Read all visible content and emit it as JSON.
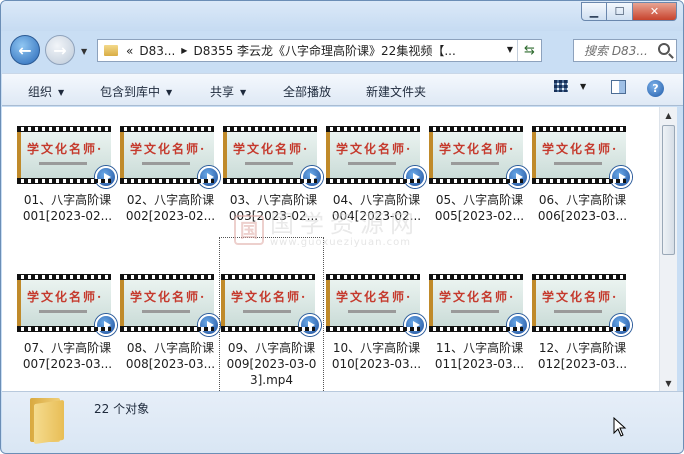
{
  "window": {
    "caption_buttons": {
      "minimize_icon": "minimize-icon",
      "maximize_icon": "maximize-icon",
      "close_icon": "close-icon"
    }
  },
  "nav": {
    "back_icon": "back-arrow-icon",
    "forward_icon": "forward-arrow-icon"
  },
  "address": {
    "overflow": "«",
    "crumbs": [
      "D83...",
      "D8355 李云龙《八字命理高阶课》22集视频【..."
    ]
  },
  "search": {
    "placeholder": "搜索 D83..."
  },
  "toolbar": {
    "organize": "组织",
    "include_library": "包含到库中",
    "share": "共享",
    "play_all": "全部播放",
    "new_folder": "新建文件夹"
  },
  "thumbnail": {
    "title_text": "学文化名师·"
  },
  "files": [
    {
      "line1": "01、八字高阶课",
      "line2": "001[2023-02..."
    },
    {
      "line1": "02、八字高阶课",
      "line2": "002[2023-02..."
    },
    {
      "line1": "03、八字高阶课",
      "line2": "003[2023-02..."
    },
    {
      "line1": "04、八字高阶课",
      "line2": "004[2023-02..."
    },
    {
      "line1": "05、八字高阶课",
      "line2": "005[2023-02..."
    },
    {
      "line1": "06、八字高阶课",
      "line2": "006[2023-03..."
    },
    {
      "line1": "07、八字高阶课",
      "line2": "007[2023-03..."
    },
    {
      "line1": "08、八字高阶课",
      "line2": "008[2023-03..."
    },
    {
      "line1": "09、八字高阶课",
      "line2": "009[2023-03-0",
      "line3": "3].mp4"
    },
    {
      "line1": "10、八字高阶课",
      "line2": "010[2023-03..."
    },
    {
      "line1": "11、八字高阶课",
      "line2": "011[2023-03..."
    },
    {
      "line1": "12、八字高阶课",
      "line2": "012[2023-03..."
    }
  ],
  "watermark": {
    "logo": "国",
    "cn": "国学资源网",
    "url": "www.guoxueziyuan.com"
  },
  "details": {
    "count": "22 个对象"
  }
}
